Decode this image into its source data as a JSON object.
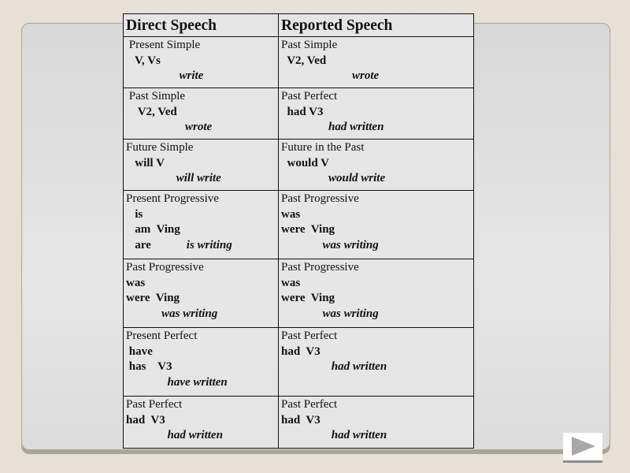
{
  "table": {
    "headers": {
      "direct": "Direct Speech",
      "reported": "Reported Speech"
    },
    "rows": [
      {
        "direct": [
          {
            "text": " Present Simple",
            "style": "normal"
          },
          {
            "text": "   V, Vs",
            "style": "formula"
          },
          {
            "text": "                  write",
            "style": "example"
          }
        ],
        "reported": [
          {
            "text": "Past Simple",
            "style": "normal"
          },
          {
            "text": "  V2, Ved",
            "style": "formula"
          },
          {
            "text": "                        wrote",
            "style": "example"
          }
        ]
      },
      {
        "direct": [
          {
            "text": " Past Simple",
            "style": "normal"
          },
          {
            "text": "    V2, Ved",
            "style": "formula"
          },
          {
            "text": "                    wrote",
            "style": "example"
          }
        ],
        "reported": [
          {
            "text": "Past Perfect",
            "style": "normal"
          },
          {
            "text": "  had V3",
            "style": "formula"
          },
          {
            "text": "                had written",
            "style": "example"
          }
        ]
      },
      {
        "direct": [
          {
            "text": "Future Simple",
            "style": "normal"
          },
          {
            "text": "   will V",
            "style": "formula"
          },
          {
            "text": "                 will write",
            "style": "example"
          }
        ],
        "reported": [
          {
            "text": "Future in the Past",
            "style": "normal"
          },
          {
            "text": "  would V",
            "style": "formula"
          },
          {
            "text": "                would write",
            "style": "example"
          }
        ]
      },
      {
        "direct": [
          {
            "text": "Present Progressive",
            "style": "normal"
          },
          {
            "text": "   is",
            "style": "formula"
          },
          {
            "text": "   am  Ving",
            "style": "formula"
          },
          {
            "text": "   are            is writing",
            "style": "formula-example"
          }
        ],
        "reported": [
          {
            "text": "Past Progressive",
            "style": "normal"
          },
          {
            "text": "was",
            "style": "formula"
          },
          {
            "text": "were  Ving",
            "style": "formula"
          },
          {
            "text": "              was writing",
            "style": "example"
          }
        ]
      },
      {
        "direct": [
          {
            "text": "Past Progressive",
            "style": "normal"
          },
          {
            "text": "was",
            "style": "formula"
          },
          {
            "text": "were  Ving",
            "style": "formula"
          },
          {
            "text": "            was writing",
            "style": "example"
          }
        ],
        "reported": [
          {
            "text": "Past Progressive",
            "style": "normal"
          },
          {
            "text": "was",
            "style": "formula"
          },
          {
            "text": "were  Ving",
            "style": "formula"
          },
          {
            "text": "              was writing",
            "style": "example"
          }
        ]
      },
      {
        "direct": [
          {
            "text": "Present Perfect",
            "style": "normal"
          },
          {
            "text": " have",
            "style": "formula"
          },
          {
            "text": " has    V3",
            "style": "formula"
          },
          {
            "text": "              have written",
            "style": "example"
          }
        ],
        "reported": [
          {
            "text": "Past Perfect",
            "style": "normal"
          },
          {
            "text": "had  V3",
            "style": "formula"
          },
          {
            "text": "                 had written",
            "style": "example"
          }
        ]
      },
      {
        "direct": [
          {
            "text": "Past Perfect",
            "style": "normal"
          },
          {
            "text": "had  V3",
            "style": "formula"
          },
          {
            "text": "              had written",
            "style": "example"
          }
        ],
        "reported": [
          {
            "text": "Past Perfect",
            "style": "normal"
          },
          {
            "text": "had  V3",
            "style": "formula"
          },
          {
            "text": "                 had written",
            "style": "example"
          }
        ]
      }
    ]
  },
  "navigation": {
    "next_icon": "play-triangle-icon"
  },
  "colors": {
    "direct_header": "#1a1ad0",
    "reported_header": "#7442b0"
  }
}
